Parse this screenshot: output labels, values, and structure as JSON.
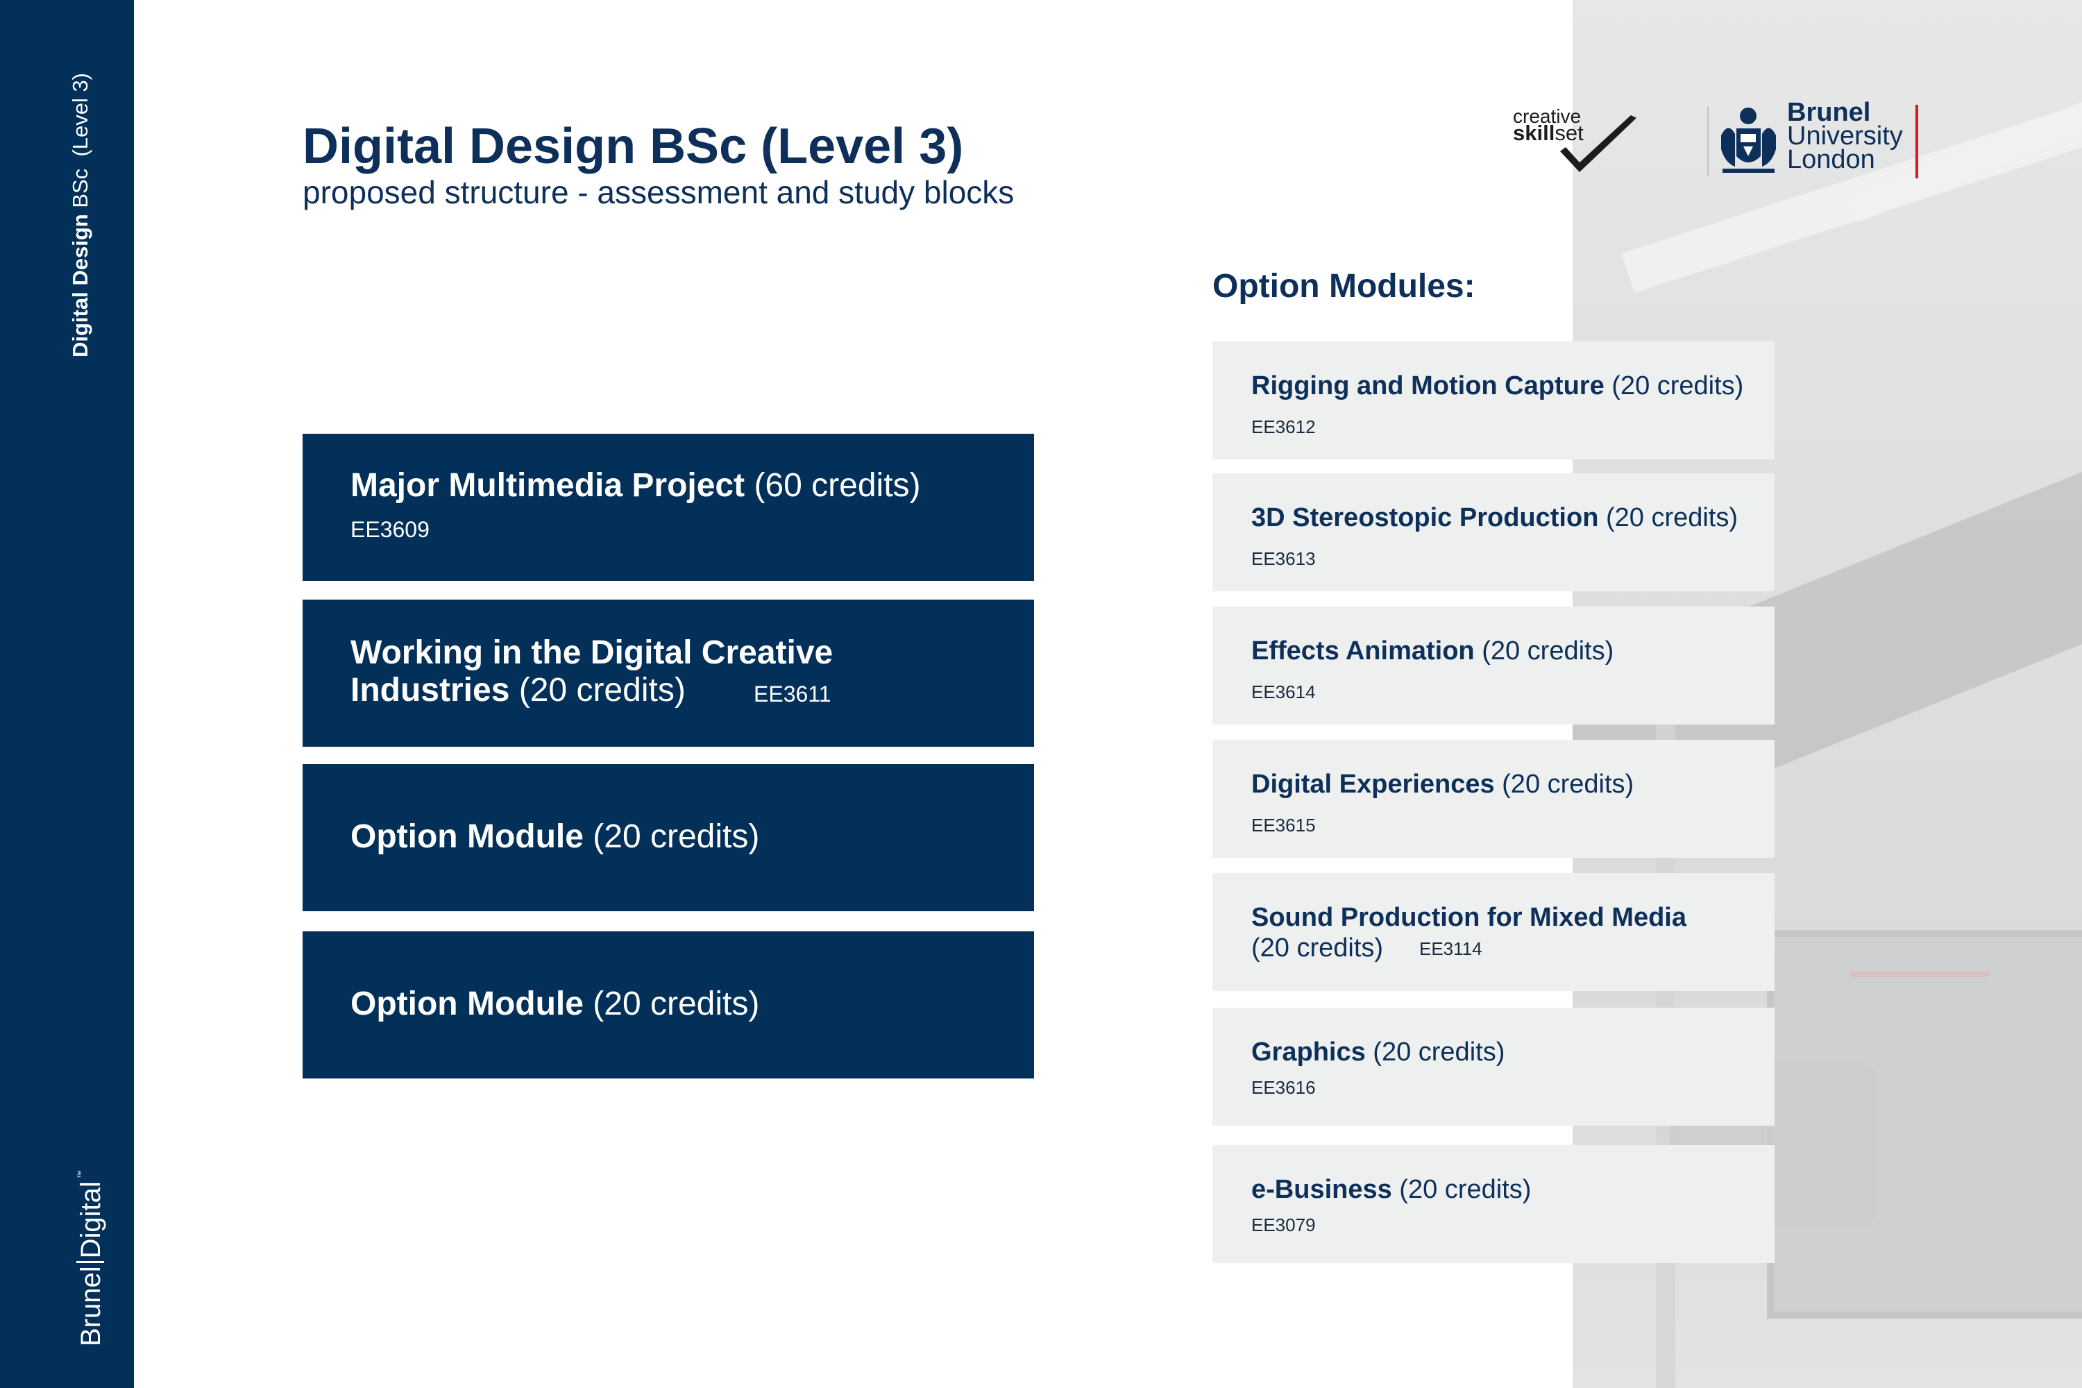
{
  "sidebar": {
    "title_bold": "Digital Design",
    "title_rest": " BSc  (Level 3)",
    "brand_left": "Brunel",
    "brand_right": "Digital",
    "brand_tm": "™"
  },
  "header": {
    "title": "Digital Design BSc (Level 3)",
    "subtitle": "proposed structure - assessment and study blocks"
  },
  "logos": {
    "skillset_line1": "creative",
    "skillset_bold": "skill",
    "skillset_rest": "set",
    "brunel_line1": "Brunel",
    "brunel_line2": "University",
    "brunel_line3": "London"
  },
  "core_modules": [
    {
      "name": "Major Multimedia Project",
      "credits": " (60 credits)",
      "code": "EE3609"
    },
    {
      "name_line1": "Working in the Digital Creative",
      "name_line2": "Industries",
      "credits": " (20 credits)",
      "code": "EE3611"
    },
    {
      "name": "Option Module",
      "credits": " (20 credits)"
    },
    {
      "name": "Option Module",
      "credits": " (20 credits)"
    }
  ],
  "option_heading": "Option Modules:",
  "option_modules": [
    {
      "name": "Rigging and Motion Capture",
      "credits": " (20 credits)",
      "code": "EE3612"
    },
    {
      "name": "3D Stereostopic Production",
      "credits": " (20 credits)",
      "code": "EE3613"
    },
    {
      "name": "Effects Animation",
      "credits": " (20 credits)",
      "code": "EE3614"
    },
    {
      "name": "Digital Experiences",
      "credits": " (20 credits)",
      "code": "EE3615"
    },
    {
      "name": "Sound Production for Mixed Media",
      "credits": "(20 credits)",
      "code": "EE3114"
    },
    {
      "name": "Graphics",
      "credits": " (20 credits)",
      "code": "EE3616"
    },
    {
      "name": "e-Business",
      "credits": " (20 credits)",
      "code": "EE3079"
    }
  ]
}
